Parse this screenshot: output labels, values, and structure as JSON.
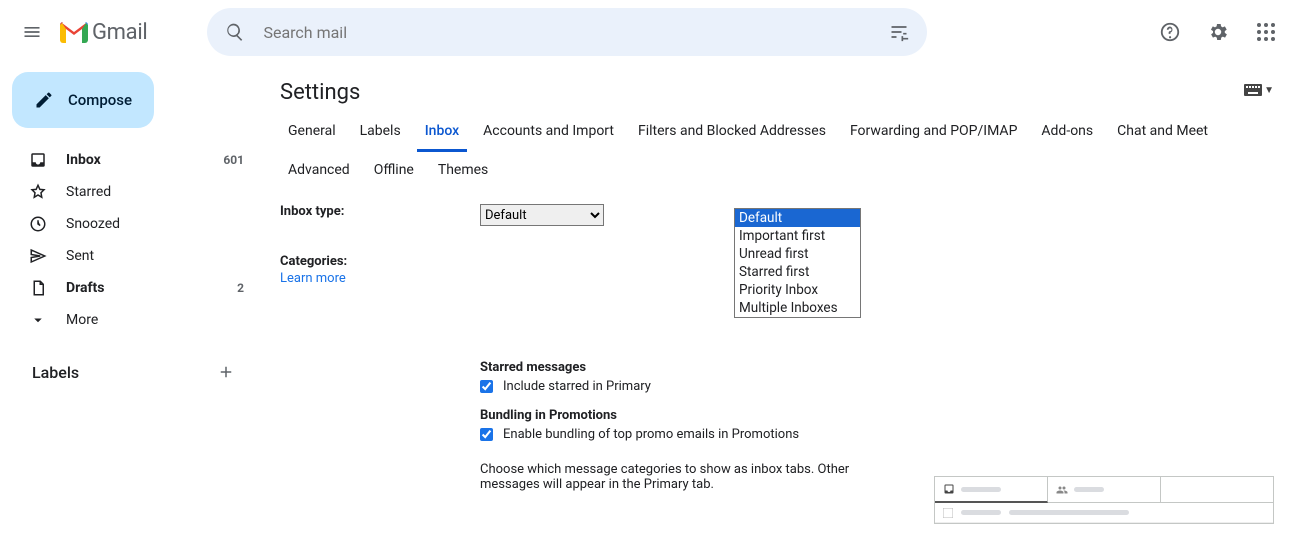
{
  "header": {
    "product": "Gmail",
    "search_placeholder": "Search mail"
  },
  "sidebar": {
    "compose": "Compose",
    "items": [
      {
        "icon": "inbox",
        "label": "Inbox",
        "count": "601",
        "bold": true
      },
      {
        "icon": "star",
        "label": "Starred",
        "count": "",
        "bold": false
      },
      {
        "icon": "clock",
        "label": "Snoozed",
        "count": "",
        "bold": false
      },
      {
        "icon": "send",
        "label": "Sent",
        "count": "",
        "bold": false
      },
      {
        "icon": "file",
        "label": "Drafts",
        "count": "2",
        "bold": true
      },
      {
        "icon": "chev",
        "label": "More",
        "count": "",
        "bold": false
      }
    ],
    "labels_heading": "Labels"
  },
  "settings": {
    "title": "Settings",
    "tabs": [
      "General",
      "Labels",
      "Inbox",
      "Accounts and Import",
      "Filters and Blocked Addresses",
      "Forwarding and POP/IMAP",
      "Add-ons",
      "Chat and Meet",
      "Advanced",
      "Offline",
      "Themes"
    ],
    "active_tab": 2,
    "inbox_type_label": "Inbox type:",
    "inbox_type_selected": "Default",
    "inbox_type_options": [
      "Default",
      "Important first",
      "Unread first",
      "Starred first",
      "Priority Inbox",
      "Multiple Inboxes"
    ],
    "categories_label": "Categories:",
    "learn_more": "Learn more",
    "starred_heading": "Starred messages",
    "starred_checkbox_label": "Include starred in Primary",
    "starred_checked": true,
    "bundling_heading": "Bundling in Promotions",
    "bundling_checkbox_label": "Enable bundling of top promo emails in Promotions",
    "bundling_checked": true,
    "hint": "Choose which message categories to show as inbox tabs. Other messages will appear in the Primary tab."
  }
}
